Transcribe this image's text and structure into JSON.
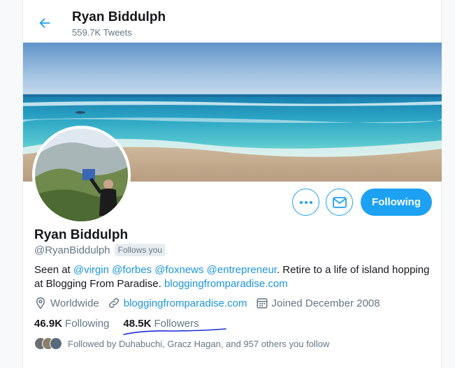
{
  "header": {
    "title": "Ryan Biddulph",
    "subtitle": "559.7K Tweets"
  },
  "profile": {
    "name": "Ryan Biddulph",
    "handle": "@RyanBiddulph",
    "follows_you_badge": "Follows you",
    "bio": {
      "prefix": "Seen at ",
      "mentions": [
        "@virgin",
        "@forbes",
        "@foxnews",
        "@entrepreneur"
      ],
      "middle": ". Retire to a life of island hopping at Blogging From Paradise. ",
      "link": "bloggingfromparadise.com"
    },
    "location": "Worldwide",
    "website": "bloggingfromparadise.com",
    "joined": "Joined December 2008"
  },
  "actions": {
    "follow_label": "Following"
  },
  "stats": {
    "following_count": "46.9K",
    "following_label": "Following",
    "followers_count": "48.5K",
    "followers_label": "Followers"
  },
  "followed_by": "Followed by Duhabuchi, Gracz Hagan, and 957 others you follow",
  "icons": {
    "back": "arrow-left-icon",
    "more": "more-dots-icon",
    "message": "envelope-icon",
    "location": "location-pin-icon",
    "website": "link-icon",
    "joined": "calendar-icon"
  },
  "colors": {
    "accent": "#1da1f2",
    "link": "#1b95e0",
    "muted": "#657786",
    "annotation": "#1a2fd6"
  }
}
